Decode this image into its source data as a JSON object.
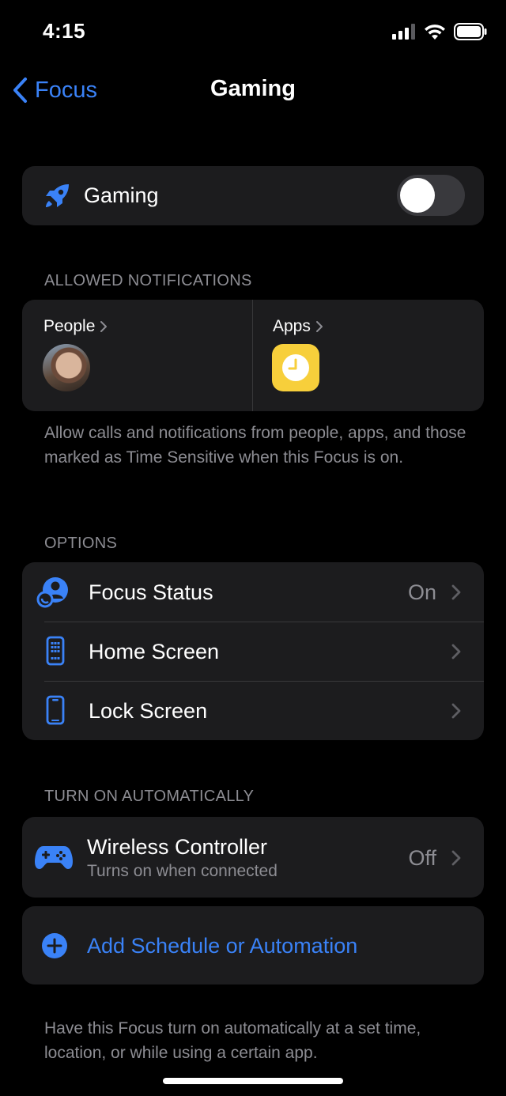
{
  "status_bar": {
    "time": "4:15"
  },
  "nav": {
    "back_label": "Focus",
    "title": "Gaming"
  },
  "focus_toggle": {
    "label": "Gaming",
    "enabled": false
  },
  "allowed_notifications": {
    "header": "ALLOWED NOTIFICATIONS",
    "people_label": "People",
    "apps_label": "Apps",
    "footer": "Allow calls and notifications from people, apps, and those marked as Time Sensitive when this Focus is on."
  },
  "options": {
    "header": "OPTIONS",
    "items": [
      {
        "label": "Focus Status",
        "value": "On",
        "icon": "focus-status-icon"
      },
      {
        "label": "Home Screen",
        "value": "",
        "icon": "home-screen-icon"
      },
      {
        "label": "Lock Screen",
        "value": "",
        "icon": "lock-screen-icon"
      }
    ]
  },
  "automation": {
    "header": "TURN ON AUTOMATICALLY",
    "controller": {
      "title": "Wireless Controller",
      "subtitle": "Turns on when connected",
      "value": "Off"
    },
    "add_label": "Add Schedule or Automation",
    "footer": "Have this Focus turn on automatically at a set time, location, or while using a certain app."
  },
  "colors": {
    "accent": "#3a82f7",
    "card": "#1c1c1e",
    "secondary_text": "#8d8d93",
    "app_icon": "#f7cf3b"
  }
}
